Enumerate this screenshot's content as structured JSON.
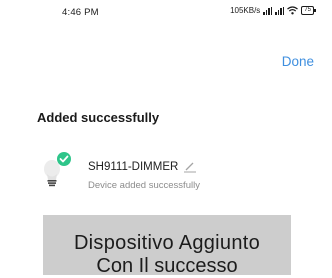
{
  "status_bar": {
    "time": "4:46 PM",
    "speed": "105KB/s",
    "battery": "75",
    "icons": [
      "signal-icon",
      "signal-icon",
      "wifi-icon",
      "battery-icon"
    ]
  },
  "header": {
    "done_label": "Done",
    "accent_color": "#3f8fdf"
  },
  "main": {
    "title": "Added successfully",
    "device": {
      "name": "SH9111-DIMMER",
      "status": "Device added successfully",
      "icon": "bulb-icon",
      "badge_icon": "check-badge-icon",
      "badge_color": "#2ec58a"
    }
  },
  "caption": {
    "line1": "Dispositivo Aggiunto",
    "line2": "Con Il successo"
  }
}
